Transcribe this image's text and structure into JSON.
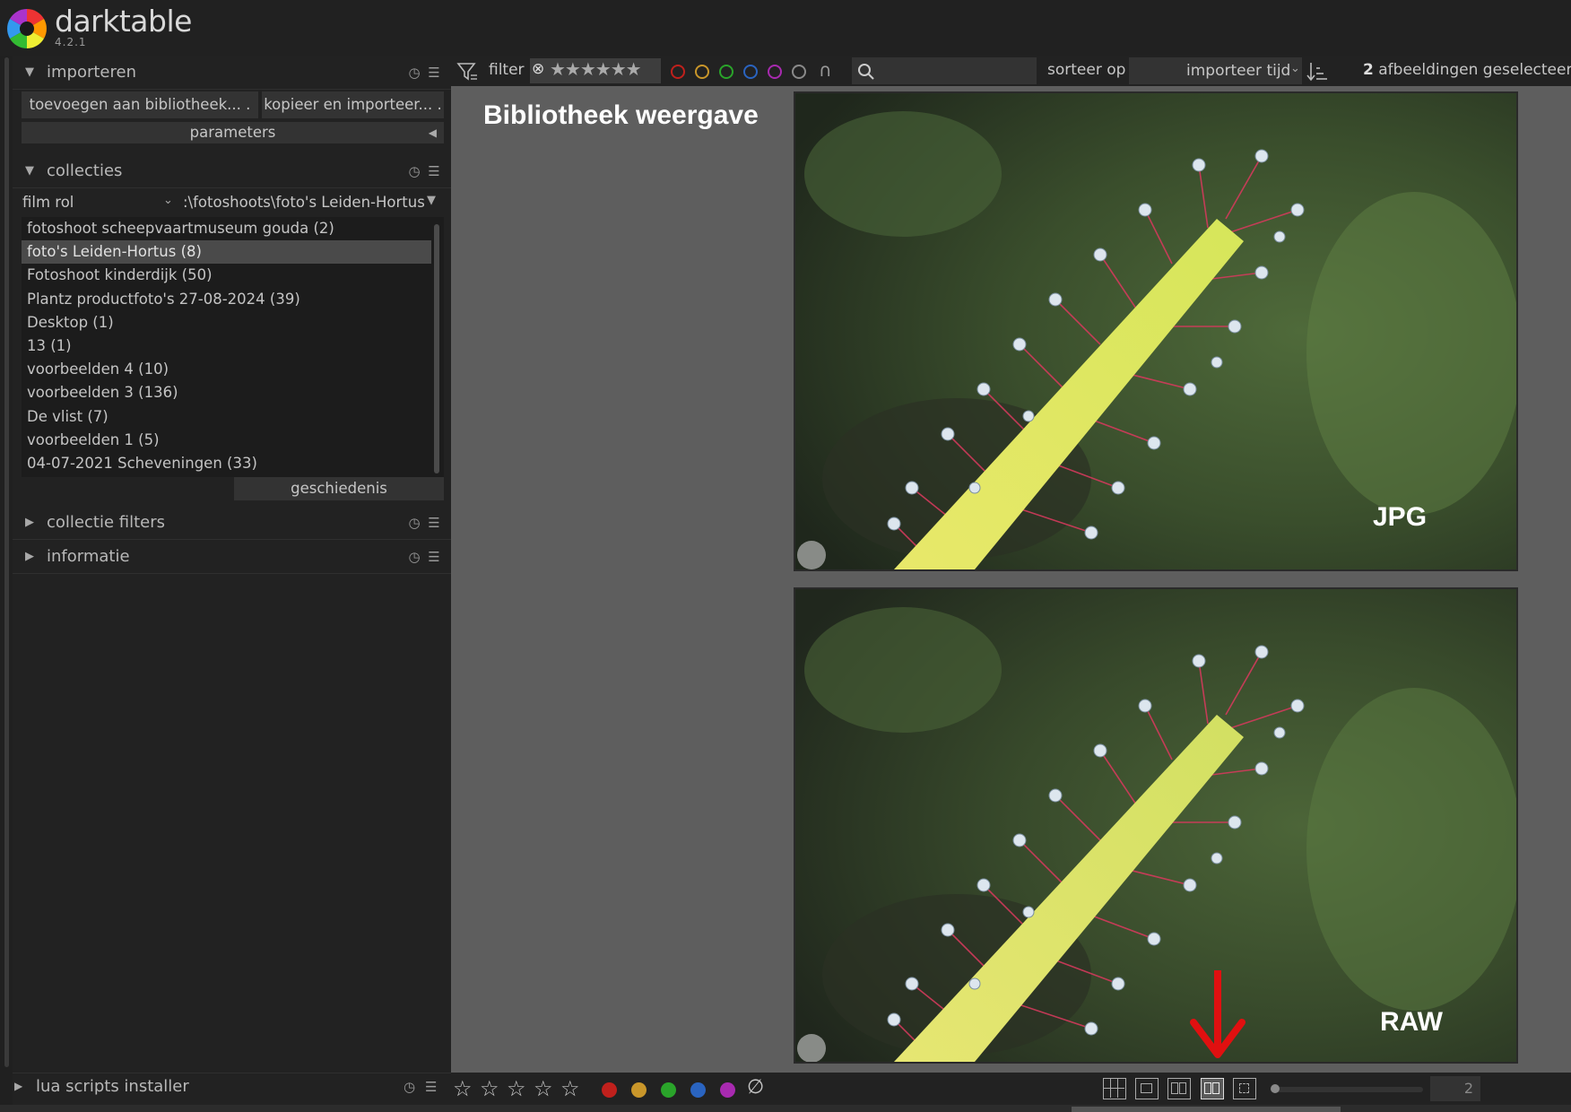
{
  "app": {
    "name": "darktable",
    "version": "4.2.1"
  },
  "modules": {
    "import": {
      "title": "importeren",
      "add_button": "toevoegen aan bibliotheek... .",
      "copy_button": "kopieer en importeer... .",
      "params_button": "parameters"
    },
    "collections": {
      "title": "collecties",
      "property": "film rol",
      "value": ":\\fotoshoots\\foto's Leiden-Hortus",
      "items": [
        "fotoshoot scheepvaartmuseum gouda (2)",
        "foto's Leiden-Hortus (8)",
        "Fotoshoot kinderdijk (50)",
        "Plantz productfoto's 27-08-2024 (39)",
        "Desktop (1)",
        "13 (1)",
        "voorbeelden 4 (10)",
        "voorbeelden 3 (136)",
        "De vlist (7)",
        "voorbeelden 1 (5)",
        "04-07-2021 Scheveningen (33)"
      ],
      "selected_index": 1,
      "history_button": "geschiedenis"
    },
    "collection_filters": {
      "title": "collectie filters"
    },
    "information": {
      "title": "informatie"
    },
    "lua": {
      "title": "lua scripts installer"
    }
  },
  "topbar": {
    "filter_label": "filter",
    "sort_label": "sorteer op",
    "sort_value": "importeer tijd",
    "selected_count": "2",
    "selected_text": "afbeeldingen geselecteerd",
    "search_placeholder": ""
  },
  "canvas": {
    "title": "Bibliotheek weergave",
    "photos": [
      {
        "label": "JPG"
      },
      {
        "label": "RAW"
      }
    ]
  },
  "bottombar": {
    "stars": [
      "☆",
      "☆",
      "☆",
      "☆",
      "☆"
    ],
    "color_labels": [
      "#c0201c",
      "#c9962a",
      "#2aa42a",
      "#2a64c0",
      "#a82ab0"
    ],
    "reject_icon": "∅",
    "zoom_count": "2"
  },
  "colors": {
    "accent_red": "#e01010",
    "panel": "#222222",
    "canvas": "#5e5e5e"
  }
}
